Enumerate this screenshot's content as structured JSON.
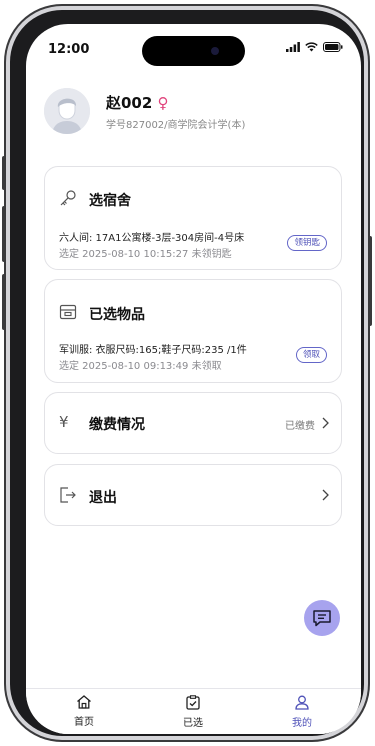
{
  "status_bar": {
    "time": "12:00"
  },
  "profile": {
    "name": "赵002",
    "gender_symbol": "♀",
    "info": "学号827002/商学院会计学(本)"
  },
  "dorm_card": {
    "title": "选宿舍",
    "detail": "六人间: 17A1公寓楼-3层-304房间-4号床",
    "selected": "选定 2025-08-10 10:15:27 未领钥匙",
    "action": "领钥匙"
  },
  "items_card": {
    "title": "已选物品",
    "detail": "军训服: 衣服尺码:165;鞋子尺码:235  /1件",
    "selected": "选定 2025-08-10 09:13:49 未领取",
    "action": "领取"
  },
  "payment_card": {
    "icon": "¥",
    "title": "缴费情况",
    "status": "已缴费"
  },
  "logout_card": {
    "title": "退出"
  },
  "tabbar": {
    "tabs": [
      {
        "label": "首页",
        "icon": "home-icon"
      },
      {
        "label": "已选",
        "icon": "clipboard-check-icon"
      },
      {
        "label": "我的",
        "icon": "user-icon",
        "active": true
      }
    ]
  },
  "colors": {
    "accent": "#4f52b8",
    "fab": "#a7a3ee",
    "female": "#e0447c"
  }
}
